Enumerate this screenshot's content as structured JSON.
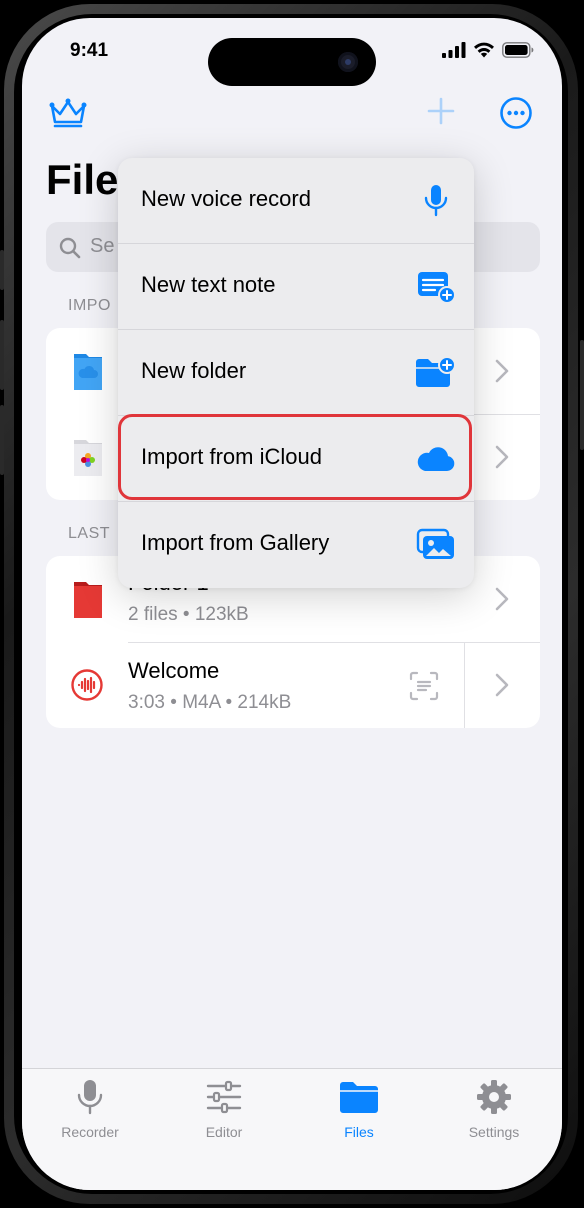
{
  "status": {
    "time": "9:41"
  },
  "header": {
    "title": "Files"
  },
  "search": {
    "placeholder": "Se"
  },
  "sections": {
    "imported_label": "IMPO",
    "last_label": "LAST"
  },
  "imported": [
    {
      "icon": "icloud-folder-icon"
    },
    {
      "icon": "photos-folder-icon"
    }
  ],
  "last": [
    {
      "title": "Folder 1",
      "subtitle": "2 files • 123kB",
      "icon": "red-folder-icon"
    },
    {
      "title": "Welcome",
      "subtitle": "3:03 • M4A • 214kB",
      "icon": "waveform-icon"
    }
  ],
  "menu": {
    "items": [
      {
        "label": "New voice record",
        "icon": "microphone-icon"
      },
      {
        "label": "New text note",
        "icon": "note-add-icon"
      },
      {
        "label": "New folder",
        "icon": "folder-add-icon"
      },
      {
        "label": "Import from iCloud",
        "icon": "cloud-icon"
      },
      {
        "label": "Import from Gallery",
        "icon": "gallery-icon"
      }
    ],
    "highlighted_index": 3
  },
  "tabs": [
    {
      "label": "Recorder",
      "icon": "microphone-icon",
      "active": false
    },
    {
      "label": "Editor",
      "icon": "sliders-icon",
      "active": false
    },
    {
      "label": "Files",
      "icon": "folder-icon",
      "active": true
    },
    {
      "label": "Settings",
      "icon": "gear-icon",
      "active": false
    }
  ],
  "colors": {
    "accent": "#0a84ff",
    "highlight": "#e0353a",
    "inactive": "#8e8e93"
  }
}
